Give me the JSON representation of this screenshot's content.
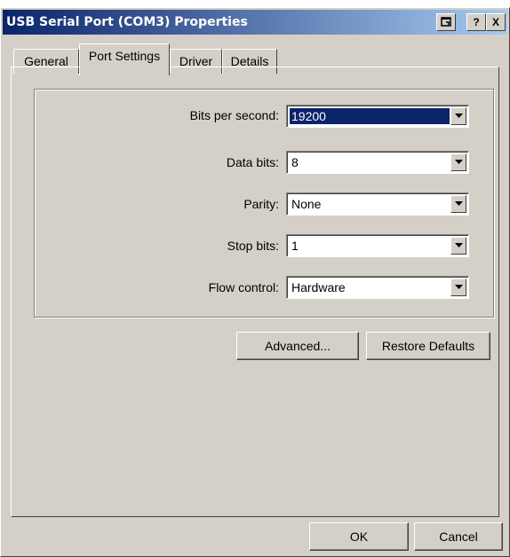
{
  "window": {
    "title": "USB Serial Port (COM3) Properties",
    "help_button_label": "?",
    "close_button_label": "X"
  },
  "tabs": [
    {
      "label": "General"
    },
    {
      "label": "Port Settings"
    },
    {
      "label": "Driver"
    },
    {
      "label": "Details"
    }
  ],
  "port_settings": {
    "bits_per_second": {
      "label": "Bits per second:",
      "value": "19200"
    },
    "data_bits": {
      "label": "Data bits:",
      "value": "8"
    },
    "parity": {
      "label": "Parity:",
      "value": "None"
    },
    "stop_bits": {
      "label": "Stop bits:",
      "value": "1"
    },
    "flow_control": {
      "label": "Flow control:",
      "value": "Hardware"
    }
  },
  "buttons": {
    "advanced": "Advanced...",
    "restore_defaults": "Restore Defaults",
    "ok": "OK",
    "cancel": "Cancel"
  },
  "colors": {
    "face": "#d4d0c8",
    "title_start": "#0a246a",
    "title_end": "#a6caf0",
    "selection": "#0a246a"
  }
}
